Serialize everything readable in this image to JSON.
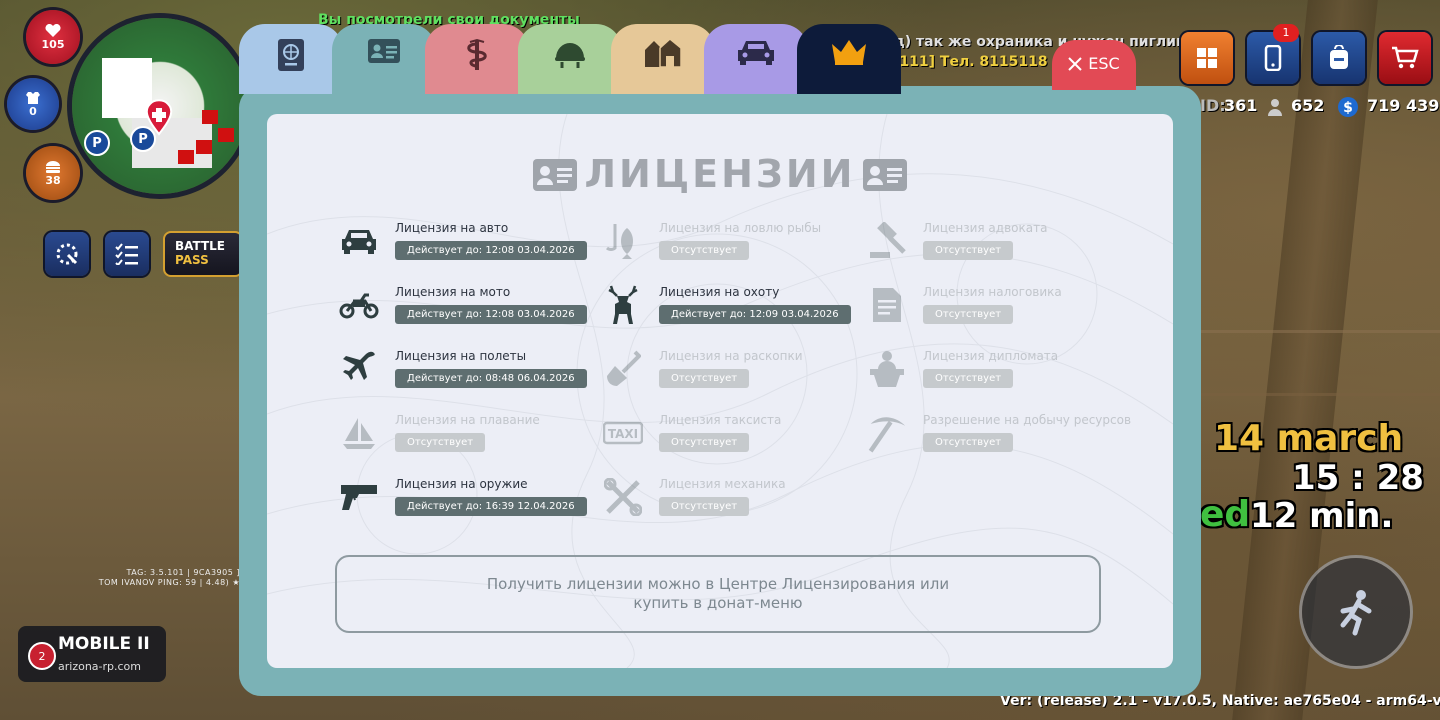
{
  "hud": {
    "health": "105",
    "armor": "0",
    "hunger": "38",
    "battle_pass": {
      "line1": "BATTLE",
      "line2": "PASS"
    },
    "tag_line1": "TAG: 3.5.101 | 9CA3905 ]",
    "tag_line2": "TOM IVANOV   PING: 59 | 4.48) ★",
    "server_name": "MOBILE II",
    "server_site": "arizona-rp.com",
    "server_number": "2"
  },
  "chat": {
    "line1": "Вы посмотрели свои документы",
    "line2": "т.д) так же охраника и нужен пиглина",
    "line3": "[111] Тел. 8115118"
  },
  "top_right": {
    "phone_badge": "1",
    "id_label": "ID:",
    "id_value": "361",
    "online": "652",
    "money": "719 439",
    "date": "14 march",
    "time": "15 : 28",
    "played_prefix": "ed",
    "played": "12 min."
  },
  "version": "Ver: (release) 2.1 - v17.0.5, Native: ae765e04 - arm64-v8a",
  "modal": {
    "tabs": [
      {
        "name": "passport",
        "color": "#a9c8e8",
        "active": false
      },
      {
        "name": "licenses",
        "color": "#7bb2b6",
        "active": true
      },
      {
        "name": "medical",
        "color": "#e08a90",
        "active": false
      },
      {
        "name": "military",
        "color": "#a8d09a",
        "active": false
      },
      {
        "name": "property",
        "color": "#e6c898",
        "active": false
      },
      {
        "name": "vehicles",
        "color": "#a89ae6",
        "active": false
      },
      {
        "name": "vip",
        "color": "#0d1b3a",
        "active": false
      }
    ],
    "esc_label": "ESC",
    "title": "ЛИЦЕНЗИИ",
    "licenses": [
      {
        "icon": "car-icon",
        "name": "Лицензия на авто",
        "status": "Действует до: 12:08 03.04.2026",
        "active": true
      },
      {
        "icon": "motorcycle-icon",
        "name": "Лицензия на мото",
        "status": "Действует до: 12:08 03.04.2026",
        "active": true
      },
      {
        "icon": "airplane-icon",
        "name": "Лицензия на полеты",
        "status": "Действует до: 08:48 06.04.2026",
        "active": true
      },
      {
        "icon": "sailboat-icon",
        "name": "Лицензия на плавание",
        "status": "Отсутствует",
        "active": false
      },
      {
        "icon": "pistol-icon",
        "name": "Лицензия на оружие",
        "status": "Действует до: 16:39 12.04.2026",
        "active": true
      },
      {
        "icon": "fishing-icon",
        "name": "Лицензия на ловлю рыбы",
        "status": "Отсутствует",
        "active": false
      },
      {
        "icon": "deer-icon",
        "name": "Лицензия на охоту",
        "status": "Действует до: 12:09 03.04.2026",
        "active": true
      },
      {
        "icon": "shovel-icon",
        "name": "Лицензия на раскопки",
        "status": "Отсутствует",
        "active": false
      },
      {
        "icon": "taxi-icon",
        "name": "Лицензия таксиста",
        "status": "Отсутствует",
        "active": false
      },
      {
        "icon": "tools-icon",
        "name": "Лицензия механика",
        "status": "Отсутствует",
        "active": false
      },
      {
        "icon": "gavel-icon",
        "name": "Лицензия адвоката",
        "status": "Отсутствует",
        "active": false
      },
      {
        "icon": "tax-document-icon",
        "name": "Лицензия налоговика",
        "status": "Отсутствует",
        "active": false
      },
      {
        "icon": "diplomat-icon",
        "name": "Лицензия дипломата",
        "status": "Отсутствует",
        "active": false
      },
      {
        "icon": "pickaxe-icon",
        "name": "Разрешение на добычу ресурсов",
        "status": "Отсутствует",
        "active": false
      }
    ],
    "note": "Получить лицензии можно в Центре Лицензирования или\nкупить в донат-меню"
  }
}
